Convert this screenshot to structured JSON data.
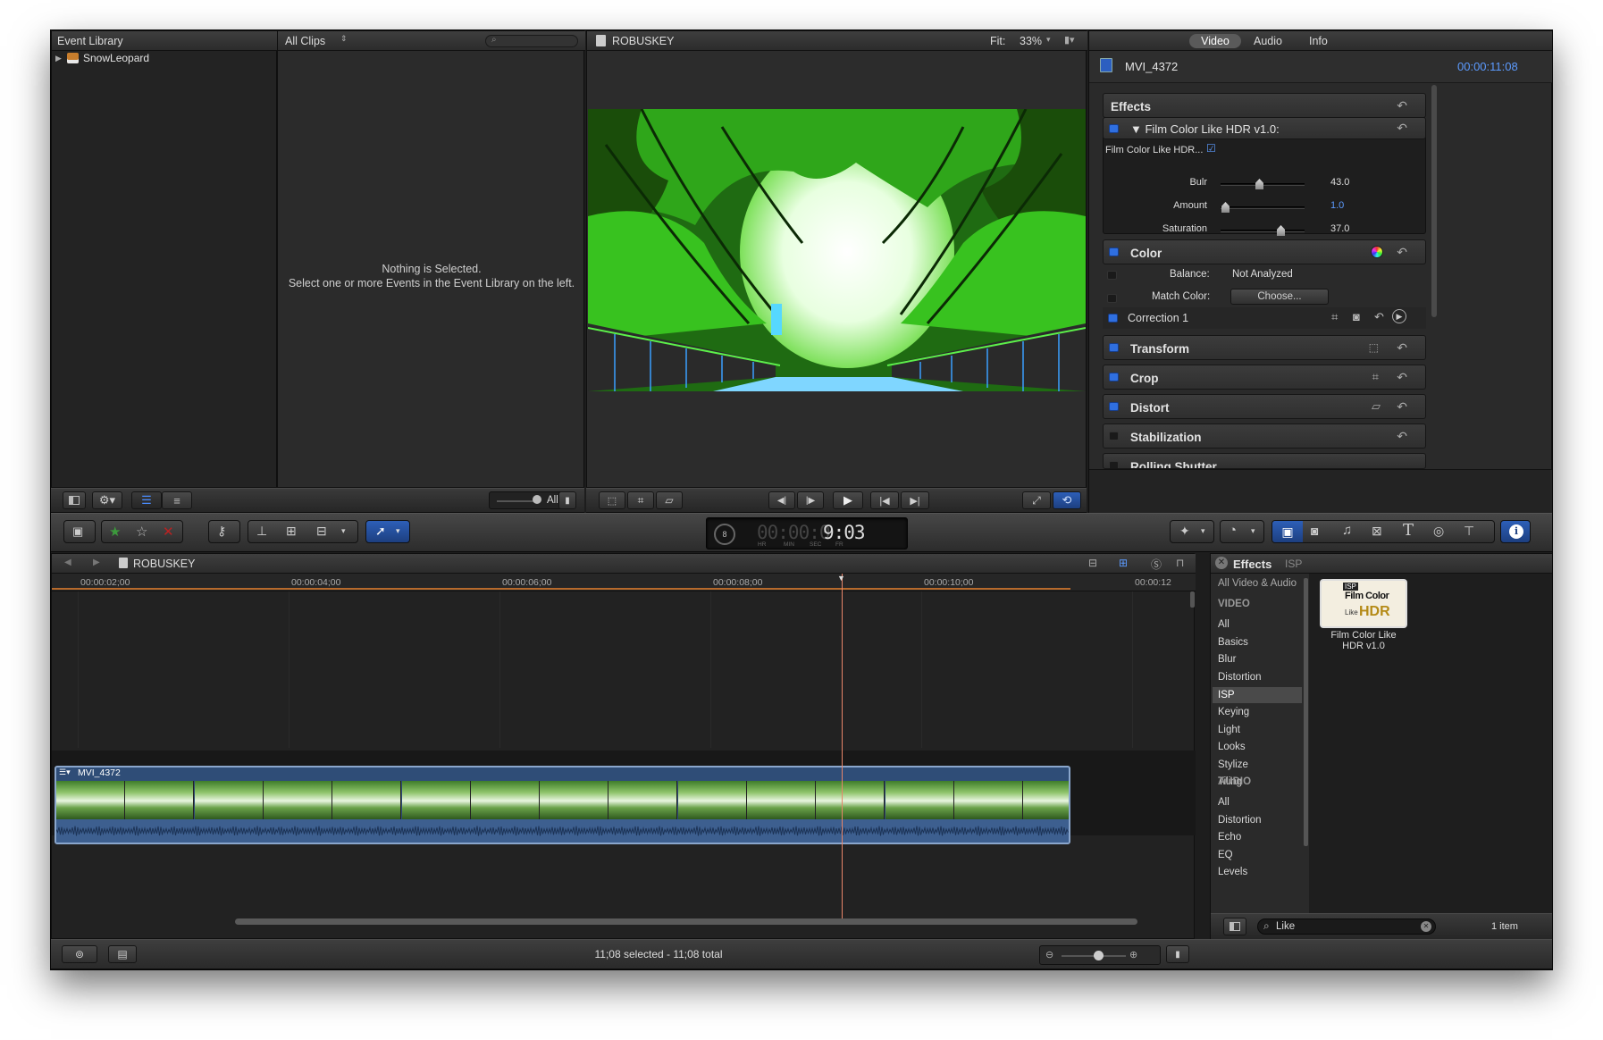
{
  "event_library": {
    "title": "Event Library",
    "item": "SnowLeopard"
  },
  "browser": {
    "filter": "All Clips",
    "empty_title": "Nothing is Selected.",
    "empty_hint": "Select one or more Events in the Event Library on the left.",
    "clip_filter": "All"
  },
  "viewer": {
    "title": "ROBUSKEY",
    "fit_label": "Fit:",
    "zoom": "33%"
  },
  "inspector": {
    "tabs": [
      "Video",
      "Audio",
      "Info"
    ],
    "clip_name": "MVI_4372",
    "duration": "00:00:11:08",
    "effects_label": "Effects",
    "effect_name": "Film Color Like HDR v1.0:",
    "effect_enable_label": "Film Color Like HDR...",
    "params": [
      {
        "label": "Bulr",
        "value": "43.0",
        "fraction": 0.43
      },
      {
        "label": "Amount",
        "value": "1.0",
        "fraction": 0.01
      },
      {
        "label": "Saturation",
        "value": "37.0",
        "fraction": 0.7
      }
    ],
    "color_label": "Color",
    "balance_label": "Balance:",
    "balance_value": "Not Analyzed",
    "match_color_label": "Match Color:",
    "match_color_button": "Choose...",
    "correction_label": "Correction 1",
    "sections": [
      "Transform",
      "Crop",
      "Distort",
      "Stabilization",
      "Rolling Shutter"
    ]
  },
  "toolbar": {
    "timecode": "9:03",
    "timecode_dim": "00:00:0",
    "timecode_units": [
      "HR",
      "MIN",
      "SEC",
      "FR"
    ],
    "percent": "8"
  },
  "timeline": {
    "project": "ROBUSKEY",
    "ruler": [
      "00:00:02;00",
      "00:00:04;00",
      "00:00:06;00",
      "00:00:08;00",
      "00:00:10;00",
      "00:00:12"
    ],
    "clip_name": "MVI_4372",
    "status": "11;08 selected - 11;08 total"
  },
  "effects_browser": {
    "title": "Effects",
    "crumb": "ISP",
    "all_label": "All Video & Audio",
    "video_heading": "VIDEO",
    "video_items": [
      "All",
      "Basics",
      "Blur",
      "Distortion",
      "ISP",
      "Keying",
      "Light",
      "Looks",
      "Stylize",
      "Tiling"
    ],
    "selected": "ISP",
    "audio_heading": "AUDIO",
    "audio_items": [
      "All",
      "Distortion",
      "Echo",
      "EQ",
      "Levels"
    ],
    "thumb_badge": "ISP",
    "thumb_text_1": "Film Color",
    "thumb_text_2": "Like",
    "thumb_text_3": "HDR",
    "thumb_caption_1": "Film Color Like",
    "thumb_caption_2": "HDR v1.0",
    "search_value": "Like",
    "count": "1 item"
  }
}
